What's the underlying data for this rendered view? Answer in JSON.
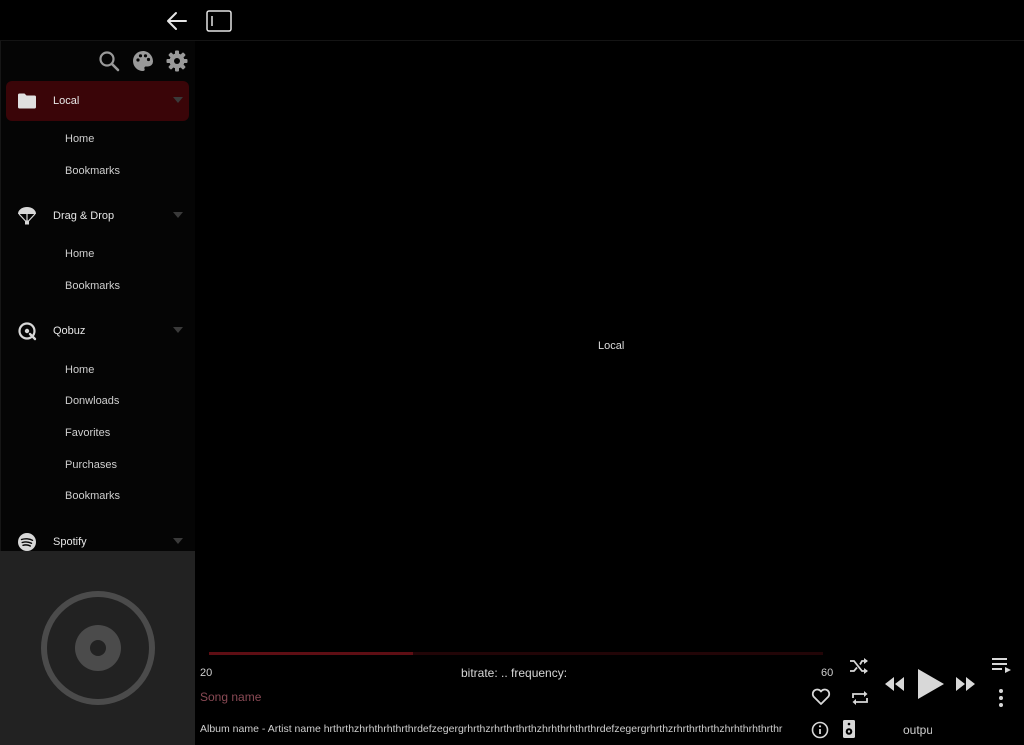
{
  "sidebar": {
    "sections": [
      {
        "label": "Local",
        "items": [
          "Home",
          "Bookmarks"
        ]
      },
      {
        "label": "Drag & Drop",
        "items": [
          "Home",
          "Bookmarks"
        ]
      },
      {
        "label": "Qobuz",
        "items": [
          "Home",
          "Donwloads",
          "Favorites",
          "Purchases",
          "Bookmarks"
        ]
      },
      {
        "label": "Spotify",
        "items": []
      }
    ],
    "active_section": "Local"
  },
  "main": {
    "label": "Local"
  },
  "player": {
    "time_start": "20",
    "time_end": "60",
    "progress": 0.333,
    "bitrate_text": "bitrate: .. frequency:",
    "song_name": "Song name",
    "album_line": "Album name  -  Artist name hrthrthzhrhthrhthrthrdefzegergrhrthzrhrthrthrthzhrhthrhthrthrdefzegergrhrthzrhrthrthrthzhrhthrhthrthr",
    "output_label": "output"
  },
  "colors": {
    "active_bg": "#3a0508",
    "progress_fill": "#5e0e14",
    "song_name": "#8a4a55"
  }
}
